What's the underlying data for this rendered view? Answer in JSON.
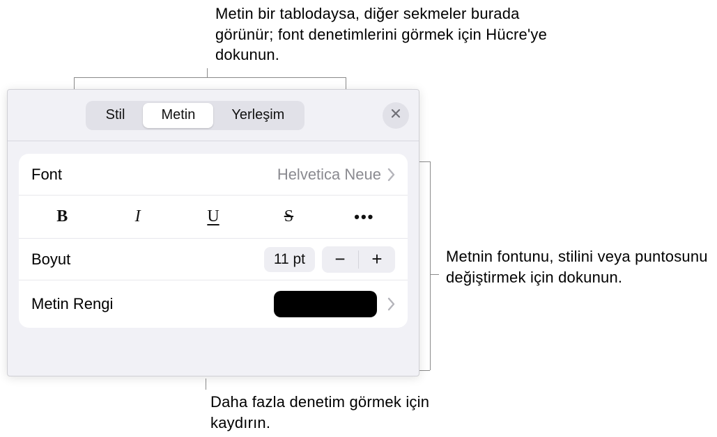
{
  "annotations": {
    "top": "Metin bir tablodaysa, diğer sekmeler burada görünür; font denetimlerini görmek için Hücre'ye dokunun.",
    "right": "Metnin fontunu, stilini veya puntosunu değiştirmek için dokunun.",
    "bottom": "Daha fazla denetim görmek için kaydırın."
  },
  "header": {
    "tabs": {
      "style": "Stil",
      "text": "Metin",
      "layout": "Yerleşim"
    }
  },
  "controls": {
    "font": {
      "label": "Font",
      "value": "Helvetica Neue"
    },
    "styles": {
      "bold": "B",
      "italic": "I",
      "underline": "U",
      "strike": "S",
      "more": "•••"
    },
    "size": {
      "label": "Boyut",
      "value": "11 pt"
    },
    "textColor": {
      "label": "Metin Rengi",
      "value": "#000000"
    }
  }
}
